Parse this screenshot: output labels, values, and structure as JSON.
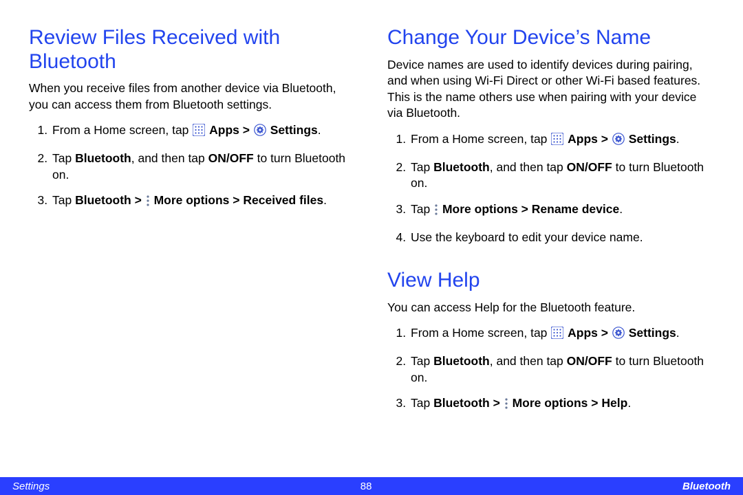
{
  "left": {
    "heading": "Review Files Received with Bluetooth",
    "intro": "When you receive files from another device via Bluetooth, you can access them from Bluetooth settings.",
    "steps": {
      "s1_pre": "From a Home screen, tap ",
      "s1_apps": "Apps",
      "s1_gt": " > ",
      "s1_settings": "Settings",
      "s1_post": ".",
      "s2_pre": "Tap ",
      "s2_bt": "Bluetooth",
      "s2_mid": ", and then tap ",
      "s2_onoff": "ON/OFF",
      "s2_post": " to turn Bluetooth on.",
      "s3_pre": "Tap ",
      "s3_bt": "Bluetooth",
      "s3_gt": " > ",
      "s3_more": "More options",
      "s3_gt2": " > ",
      "s3_rf": "Received files",
      "s3_post": "."
    }
  },
  "right_top": {
    "heading": "Change Your Device’s Name",
    "intro": "Device names are used to identify devices during pairing, and when using Wi-Fi Direct or other Wi-Fi based features. This is the name others use when pairing with your device via Bluetooth.",
    "steps": {
      "s1_pre": "From a Home screen, tap ",
      "s1_apps": "Apps",
      "s1_gt": " > ",
      "s1_settings": "Settings",
      "s1_post": ".",
      "s2_pre": "Tap ",
      "s2_bt": "Bluetooth",
      "s2_mid": ", and then tap ",
      "s2_onoff": "ON/OFF",
      "s2_post": " to turn Bluetooth on.",
      "s3_pre": "Tap ",
      "s3_more": "More options",
      "s3_gt": " > ",
      "s3_rn": "Rename device",
      "s3_post": ".",
      "s4": "Use the keyboard to edit your device name."
    }
  },
  "right_bottom": {
    "heading": "View Help",
    "intro": "You can access Help for the Bluetooth feature.",
    "steps": {
      "s1_pre": "From a Home screen, tap ",
      "s1_apps": "Apps",
      "s1_gt": " > ",
      "s1_settings": "Settings",
      "s1_post": ".",
      "s2_pre": "Tap ",
      "s2_bt": "Bluetooth",
      "s2_mid": ", and then tap ",
      "s2_onoff": "ON/OFF",
      "s2_post": " to turn Bluetooth on.",
      "s3_pre": "Tap ",
      "s3_bt": "Bluetooth",
      "s3_gt": " > ",
      "s3_more": "More options",
      "s3_gt2": " > ",
      "s3_help": "Help",
      "s3_post": "."
    }
  },
  "footer": {
    "left": "Settings",
    "page": "88",
    "right": "Bluetooth"
  }
}
